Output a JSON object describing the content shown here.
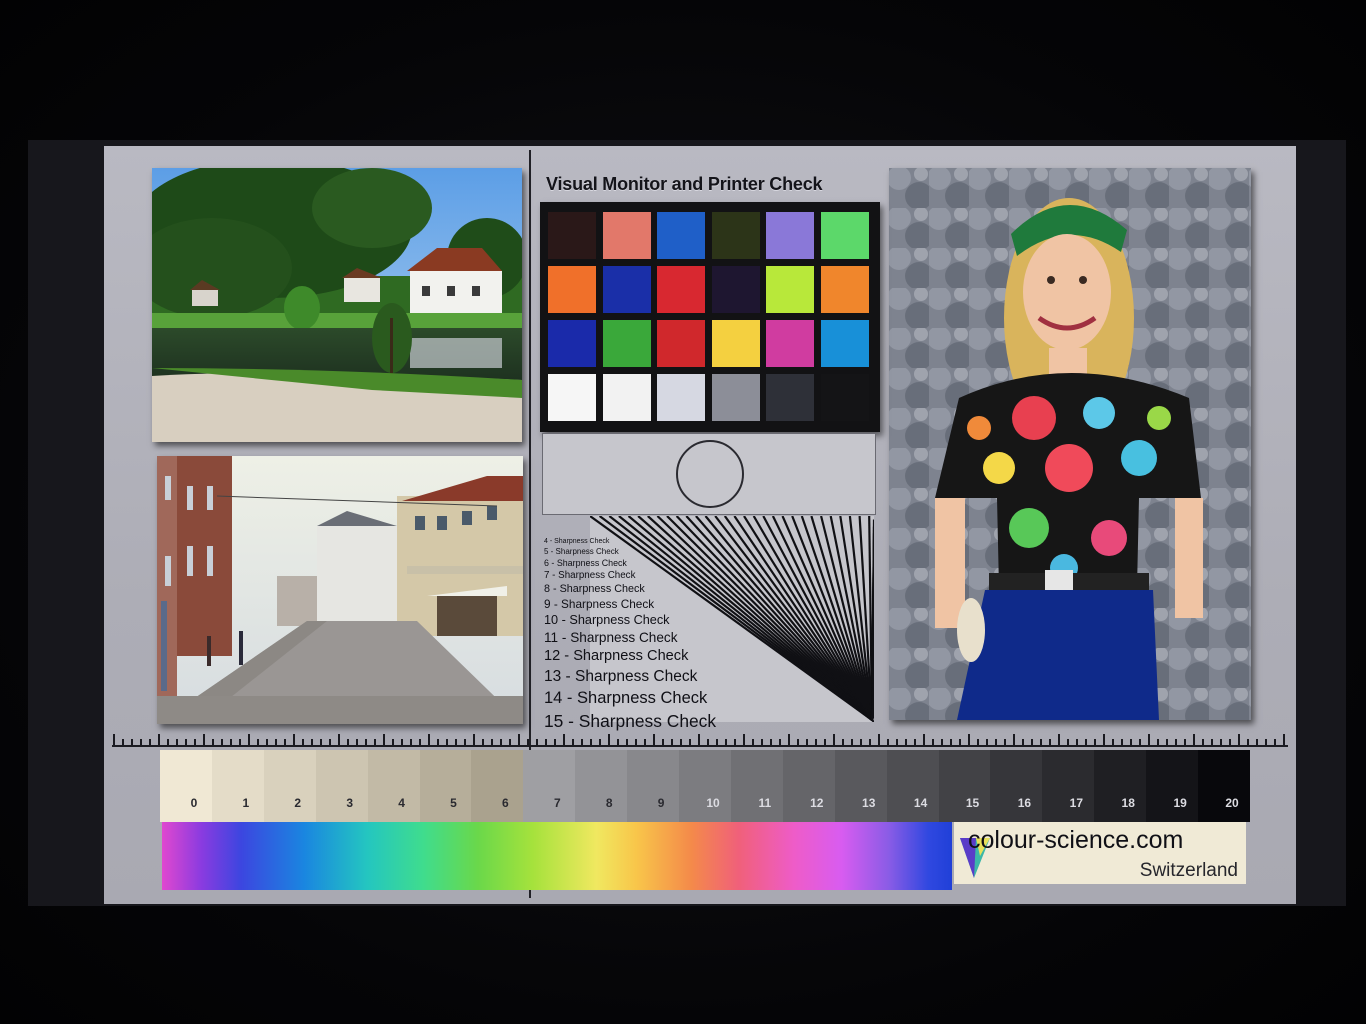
{
  "chart": {
    "title": "Visual Monitor and Printer Check",
    "color_patches": [
      "#2a1818",
      "#e2786a",
      "#1f5fc8",
      "#2c3418",
      "#8a78d8",
      "#5cd86a",
      "#f0702a",
      "#1a2fa8",
      "#d82830",
      "#1e1630",
      "#b8e83a",
      "#f0862c",
      "#1a2aaa",
      "#3aa83a",
      "#d0282c",
      "#f4d040",
      "#d03ca0",
      "#1890d8",
      "#f6f6f6",
      "#f2f2f2",
      "#d6d8e2",
      "#8c8e98",
      "#2e3038",
      "#141416"
    ],
    "sharpness_items": [
      "4 - Sharpness Check",
      "5 - Sharpness Check",
      "6 - Sharpness Check",
      "7 - Sharpness Check",
      "8 - Sharpness Check",
      "9 - Sharpness Check",
      "10 - Sharpness Check",
      "11 - Sharpness Check",
      "12 - Sharpness Check",
      "13 - Sharpness Check",
      "14 - Sharpness Check",
      "15 - Sharpness Check"
    ]
  },
  "gray_scale": {
    "labels": [
      "0",
      "1",
      "2",
      "3",
      "4",
      "5",
      "6",
      "7",
      "8",
      "9",
      "10",
      "11",
      "12",
      "13",
      "14",
      "15",
      "16",
      "17",
      "18",
      "19",
      "20"
    ]
  },
  "branding": {
    "site": "colour-science.com",
    "country": "Switzerland"
  },
  "photos": {
    "top_left": "lake-village-photo",
    "bottom_left": "street-photo",
    "right": "portrait-photo"
  }
}
